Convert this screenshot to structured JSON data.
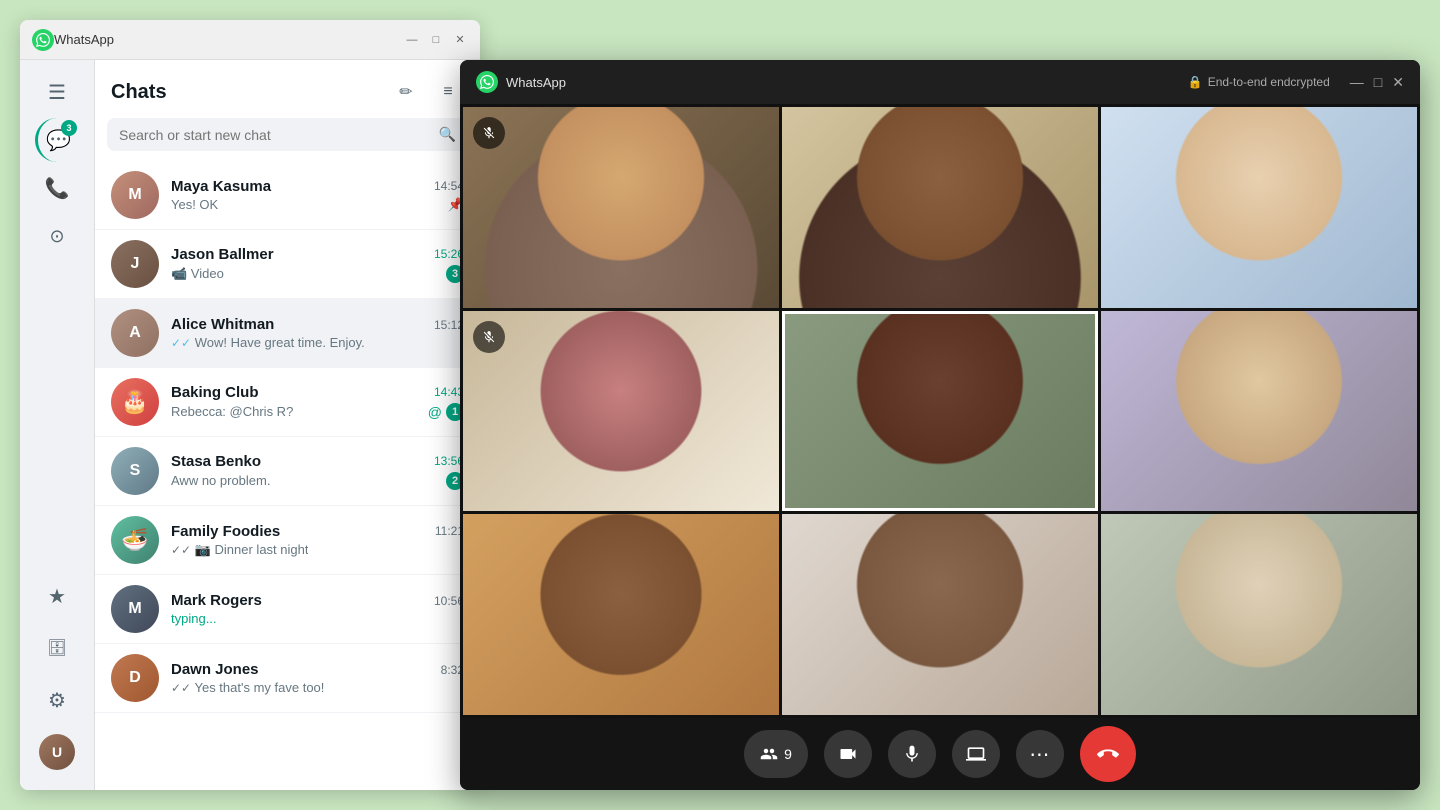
{
  "whatsapp_window": {
    "titlebar": {
      "title": "WhatsApp",
      "min_label": "—",
      "max_label": "□",
      "close_label": "✕"
    },
    "sidebar": {
      "badge_count": "3",
      "items": [
        {
          "name": "menu",
          "icon": "☰"
        },
        {
          "name": "chats",
          "icon": "💬",
          "badge": "3"
        },
        {
          "name": "calls",
          "icon": "📞"
        },
        {
          "name": "status",
          "icon": "⊙"
        },
        {
          "name": "starred",
          "icon": "★"
        },
        {
          "name": "archived",
          "icon": "🗄"
        },
        {
          "name": "settings",
          "icon": "⚙"
        },
        {
          "name": "profile",
          "icon": "👤"
        }
      ]
    },
    "chats_panel": {
      "title": "Chats",
      "edit_icon": "✏",
      "filter_icon": "≡",
      "search_placeholder": "Search or start new chat",
      "chats": [
        {
          "id": "maya",
          "name": "Maya Kasuma",
          "preview": "Yes! OK",
          "time": "14:54",
          "unread": false,
          "pinned": true,
          "avatar_initial": "M",
          "double_check": true,
          "check_color": "grey"
        },
        {
          "id": "jason",
          "name": "Jason Ballmer",
          "preview": "📹 Video",
          "time": "15:26",
          "unread": true,
          "unread_count": "3",
          "avatar_initial": "J",
          "double_check": false
        },
        {
          "id": "alice",
          "name": "Alice Whitman",
          "preview": "✓✓ Wow! Have great time. Enjoy.",
          "time": "15:12",
          "unread": false,
          "active": true,
          "avatar_initial": "A",
          "double_check": true,
          "check_color": "blue"
        },
        {
          "id": "baking",
          "name": "Baking Club",
          "preview": "Rebecca: @Chris R?",
          "time": "14:43",
          "unread": true,
          "unread_count": "1",
          "mention": true,
          "avatar_initial": "🎂"
        },
        {
          "id": "stasa",
          "name": "Stasa Benko",
          "preview": "Aww no problem.",
          "time": "13:56",
          "unread": true,
          "unread_count": "2",
          "avatar_initial": "S"
        },
        {
          "id": "family",
          "name": "Family Foodies",
          "preview": "✓✓ 📷 Dinner last night",
          "time": "11:21",
          "unread": false,
          "avatar_initial": "🍜",
          "double_check": true
        },
        {
          "id": "mark",
          "name": "Mark Rogers",
          "preview": "typing...",
          "time": "10:56",
          "unread": false,
          "typing": true,
          "avatar_initial": "M"
        },
        {
          "id": "dawn",
          "name": "Dawn Jones",
          "preview": "✓✓ Yes that's my fave too!",
          "time": "8:32",
          "unread": false,
          "avatar_initial": "D",
          "double_check": true,
          "check_color": "grey"
        }
      ]
    }
  },
  "call_window": {
    "titlebar": {
      "title": "WhatsApp",
      "encrypted_label": "End-to-end endcrypted",
      "min_label": "—",
      "max_label": "□",
      "close_label": "✕"
    },
    "controls": {
      "participants_count": "9",
      "participants_label": "9",
      "video_label": "📹",
      "mic_label": "🎙",
      "screen_label": "⬛",
      "more_label": "⋯",
      "end_label": "📞"
    },
    "participants": [
      {
        "id": 1,
        "muted": true,
        "speaking": false
      },
      {
        "id": 2,
        "muted": false,
        "speaking": false
      },
      {
        "id": 3,
        "muted": false,
        "speaking": false
      },
      {
        "id": 4,
        "muted": true,
        "speaking": false
      },
      {
        "id": 5,
        "muted": false,
        "speaking": true
      },
      {
        "id": 6,
        "muted": false,
        "speaking": false
      },
      {
        "id": 7,
        "muted": false,
        "speaking": false
      },
      {
        "id": 8,
        "muted": false,
        "speaking": false
      },
      {
        "id": 9,
        "muted": false,
        "speaking": false
      }
    ]
  }
}
